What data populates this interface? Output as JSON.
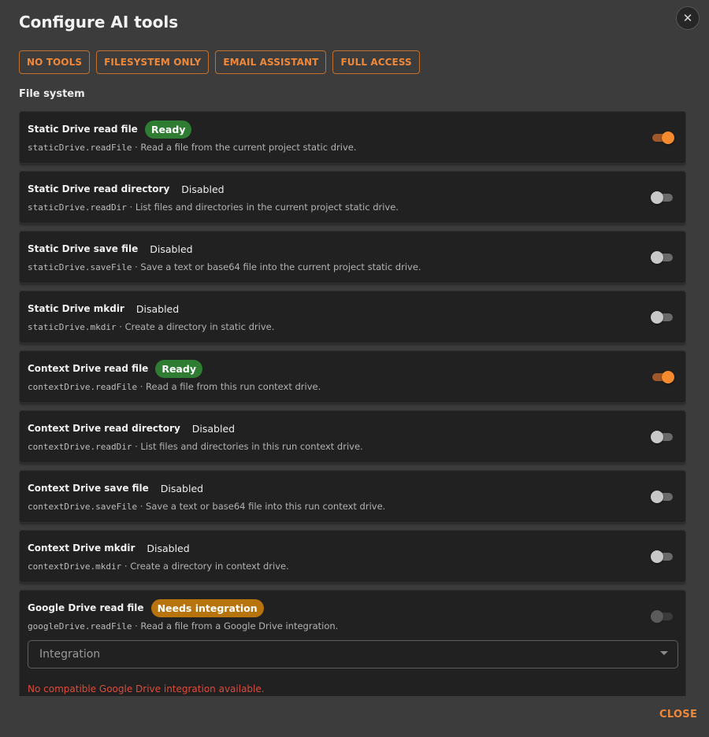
{
  "dialog": {
    "title": "Configure AI tools",
    "close_icon": "close-icon",
    "close_label": "CLOSE"
  },
  "presets": [
    {
      "label": "NO TOOLS"
    },
    {
      "label": "FILESYSTEM ONLY"
    },
    {
      "label": "EMAIL ASSISTANT"
    },
    {
      "label": "FULL ACCESS"
    }
  ],
  "colors": {
    "accent": "#f0883a",
    "ready": "#2e7d32",
    "needs_integration": "#b8740c",
    "error": "#e04a3a"
  },
  "section": {
    "title": "File system"
  },
  "tools": [
    {
      "name": "Static Drive read file",
      "status": "Ready",
      "code": "staticDrive.readFile",
      "sep": " · ",
      "description": "Read a file from the current project static drive.",
      "enabled": true
    },
    {
      "name": "Static Drive read directory",
      "status": "Disabled",
      "code": "staticDrive.readDir",
      "sep": " · ",
      "description": "List files and directories in the current project static drive.",
      "enabled": false
    },
    {
      "name": "Static Drive save file",
      "status": "Disabled",
      "code": "staticDrive.saveFile",
      "sep": " · ",
      "description": "Save a text or base64 file into the current project static drive.",
      "enabled": false
    },
    {
      "name": "Static Drive mkdir",
      "status": "Disabled",
      "code": "staticDrive.mkdir",
      "sep": " · ",
      "description": "Create a directory in static drive.",
      "enabled": false
    },
    {
      "name": "Context Drive read file",
      "status": "Ready",
      "code": "contextDrive.readFile",
      "sep": " · ",
      "description": "Read a file from this run context drive.",
      "enabled": true
    },
    {
      "name": "Context Drive read directory",
      "status": "Disabled",
      "code": "contextDrive.readDir",
      "sep": " · ",
      "description": "List files and directories in this run context drive.",
      "enabled": false
    },
    {
      "name": "Context Drive save file",
      "status": "Disabled",
      "code": "contextDrive.saveFile",
      "sep": " · ",
      "description": "Save a text or base64 file into this run context drive.",
      "enabled": false
    },
    {
      "name": "Context Drive mkdir",
      "status": "Disabled",
      "code": "contextDrive.mkdir",
      "sep": " · ",
      "description": "Create a directory in context drive.",
      "enabled": false
    },
    {
      "name": "Google Drive read file",
      "status": "Needs integration",
      "code": "googleDrive.readFile",
      "sep": " · ",
      "description": "Read a file from a Google Drive integration.",
      "enabled": false,
      "integration": {
        "label": "Integration",
        "error": "No compatible Google Drive integration available."
      }
    }
  ]
}
